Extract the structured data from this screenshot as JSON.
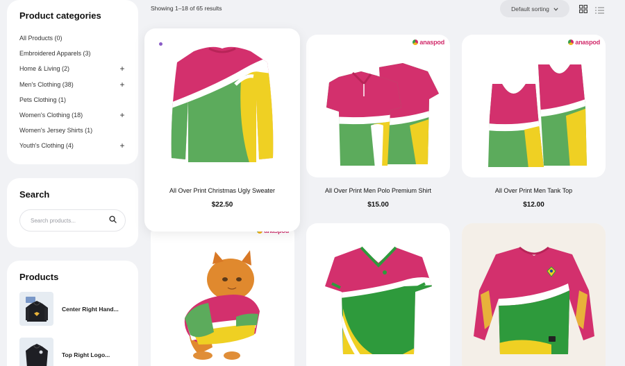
{
  "sidebar": {
    "categories_title": "Product categories",
    "categories": [
      {
        "label": "All Products (0)",
        "expandable": false
      },
      {
        "label": "Embroidered Apparels (3)",
        "expandable": false
      },
      {
        "label": "Home & Living (2)",
        "expandable": true
      },
      {
        "label": "Men's Clothing (38)",
        "expandable": true
      },
      {
        "label": "Pets Clothing (1)",
        "expandable": false
      },
      {
        "label": "Women's Clothing (18)",
        "expandable": true
      },
      {
        "label": "Women's Jersey Shirts (1)",
        "expandable": false
      },
      {
        "label": "Youth's Clothing (4)",
        "expandable": true
      }
    ],
    "plus_glyph": "+",
    "search_title": "Search",
    "search_placeholder": "Search products...",
    "products_title": "Products",
    "mini_products": [
      {
        "label": "Center Right Hand..."
      },
      {
        "label": "Top Right Logo..."
      }
    ]
  },
  "toolbar": {
    "results_text": "Showing 1–18 of 65 results",
    "sort_label": "Default sorting"
  },
  "brand_name": "anaspod",
  "products": [
    {
      "title": "All Over Print Christmas Ugly Sweater",
      "price": "$22.50"
    },
    {
      "title": "All Over Print Men Polo Premium Shirt",
      "price": "$15.00"
    },
    {
      "title": "All Over Print Men Tank Top",
      "price": "$12.00"
    },
    {
      "title": "",
      "price": ""
    },
    {
      "title": "",
      "price": ""
    },
    {
      "title": "",
      "price": ""
    }
  ],
  "colors": {
    "pink": "#d3306d",
    "green": "#5cab5c",
    "yellow": "#efd023",
    "white": "#ffffff",
    "page_bg": "#f1f2f5"
  }
}
